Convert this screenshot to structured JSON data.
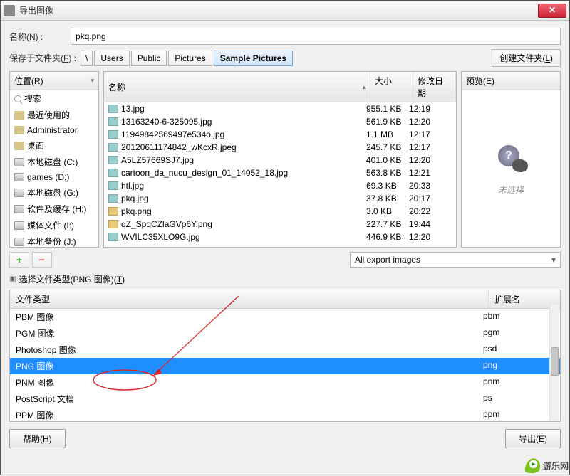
{
  "window": {
    "title": "导出图像"
  },
  "name": {
    "label_pre": "名称(",
    "label_u": "N",
    "label_post": ") :",
    "value": "pkq.png"
  },
  "savein": {
    "label_pre": "保存于文件夹(",
    "label_u": "F",
    "label_post": ") :",
    "crumbs": [
      "\\",
      "Users",
      "Public",
      "Pictures",
      "Sample Pictures"
    ]
  },
  "create_folder": {
    "pre": "创建文件夹(",
    "u": "L",
    "post": ")"
  },
  "places": {
    "header_pre": "位置(",
    "header_u": "R",
    "header_post": ")",
    "items": [
      {
        "label": "搜索",
        "icon": "search"
      },
      {
        "label": "最近使用的",
        "icon": "folder"
      },
      {
        "label": "Administrator",
        "icon": "folder"
      },
      {
        "label": "桌面",
        "icon": "folder"
      },
      {
        "label": "本地磁盘 (C:)",
        "icon": "disk"
      },
      {
        "label": "games (D:)",
        "icon": "disk"
      },
      {
        "label": "本地磁盘 (G:)",
        "icon": "disk"
      },
      {
        "label": "软件及缓存 (H:)",
        "icon": "disk"
      },
      {
        "label": "媒体文件 (I:)",
        "icon": "disk"
      },
      {
        "label": "本地备份 (J:)",
        "icon": "disk"
      }
    ]
  },
  "files": {
    "col_name": "名称",
    "col_size": "大小",
    "col_date": "修改日期",
    "rows": [
      {
        "name": "13.jpg",
        "size": "955.1 KB",
        "date": "12:19",
        "type": "jpg"
      },
      {
        "name": "13163240-6-325095.jpg",
        "size": "561.9 KB",
        "date": "12:20",
        "type": "jpg"
      },
      {
        "name": "11949842569497e534o.jpg",
        "size": "1.1 MB",
        "date": "12:17",
        "type": "jpg"
      },
      {
        "name": "20120611174842_wKcxR.jpeg",
        "size": "245.7 KB",
        "date": "12:17",
        "type": "jpg"
      },
      {
        "name": "A5LZ57669SJ7.jpg",
        "size": "401.0 KB",
        "date": "12:20",
        "type": "jpg"
      },
      {
        "name": "cartoon_da_nucu_design_01_14052_18.jpg",
        "size": "563.8 KB",
        "date": "12:21",
        "type": "jpg"
      },
      {
        "name": "htl.jpg",
        "size": "69.3 KB",
        "date": "20:33",
        "type": "jpg"
      },
      {
        "name": "pkq.jpg",
        "size": "37.8 KB",
        "date": "20:17",
        "type": "jpg"
      },
      {
        "name": "pkq.png",
        "size": "3.0 KB",
        "date": "20:22",
        "type": "png"
      },
      {
        "name": "qZ_SpqCZlaGVp6Y.png",
        "size": "227.7 KB",
        "date": "19:44",
        "type": "png"
      },
      {
        "name": "WVILC35XLO9G.jpg",
        "size": "446.9 KB",
        "date": "12:20",
        "type": "jpg"
      }
    ]
  },
  "preview": {
    "header_pre": "预览(",
    "header_u": "E",
    "header_post": ")",
    "empty": "未选择"
  },
  "filter": {
    "value": "All export images"
  },
  "expander": {
    "pre": "选择文件类型(PNG 图像)(",
    "u": "T",
    "post": ")"
  },
  "types": {
    "col_name": "文件类型",
    "col_ext": "扩展名",
    "rows": [
      {
        "name": "PBM 图像",
        "ext": "pbm"
      },
      {
        "name": "PGM 图像",
        "ext": "pgm"
      },
      {
        "name": "Photoshop 图像",
        "ext": "psd"
      },
      {
        "name": "PNG 图像",
        "ext": "png",
        "selected": true
      },
      {
        "name": "PNM 图像",
        "ext": "pnm"
      },
      {
        "name": "PostScript 文档",
        "ext": "ps"
      },
      {
        "name": "PPM 图像",
        "ext": "ppm"
      }
    ]
  },
  "help_btn": {
    "pre": "帮助(",
    "u": "H",
    "post": ")"
  },
  "export_btn": {
    "pre": "导出(",
    "u": "E",
    "post": ")"
  },
  "watermark": "游乐网"
}
